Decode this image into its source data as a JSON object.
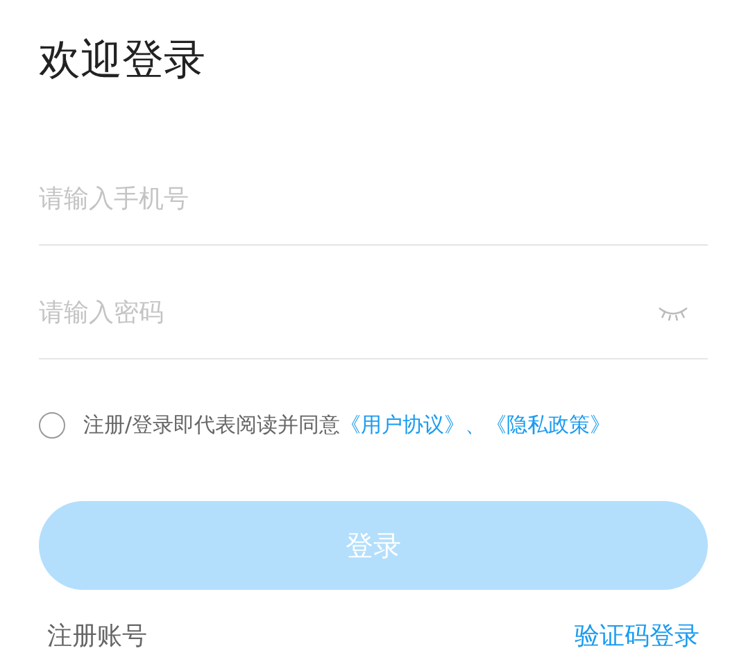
{
  "title": "欢迎登录",
  "phone_field": {
    "placeholder": "请输入手机号"
  },
  "password_field": {
    "placeholder": "请输入密码",
    "visible": false
  },
  "agreement": {
    "checked": false,
    "parts": [
      {
        "kind": "text",
        "text": "注册/登录即代表阅读并同意"
      },
      {
        "kind": "link",
        "text": "《用户协议》、《隐私政策》"
      }
    ]
  },
  "login_button": {
    "label": "登录",
    "disabled": true
  },
  "register_link": "注册账号",
  "code_login_link": "验证码登录"
}
